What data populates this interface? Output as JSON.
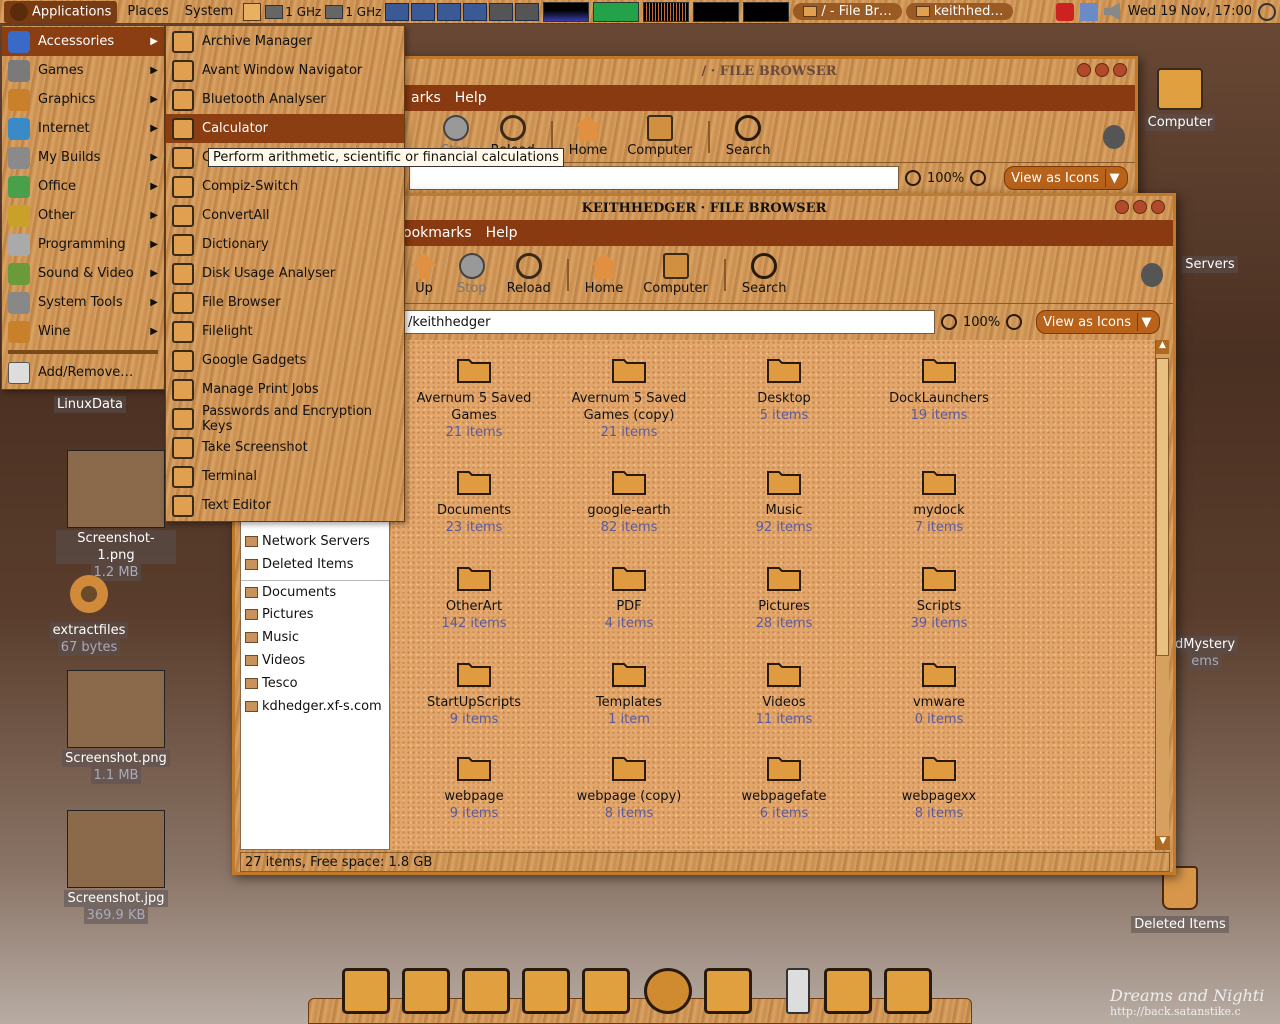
{
  "top_panel": {
    "applications": "Applications",
    "places": "Places",
    "system": "System",
    "cpu1": "1 GHz",
    "cpu2": "1 GHz",
    "task1": "/ - File Br…",
    "task2": "keithhed…",
    "clock": "Wed 19 Nov, 17:00"
  },
  "apps_menu": {
    "items": [
      {
        "label": "Accessories",
        "icon": "accessories-icon"
      },
      {
        "label": "Games",
        "icon": "games-icon"
      },
      {
        "label": "Graphics",
        "icon": "graphics-icon"
      },
      {
        "label": "Internet",
        "icon": "internet-icon"
      },
      {
        "label": "My Builds",
        "icon": "my-builds-icon"
      },
      {
        "label": "Office",
        "icon": "office-icon"
      },
      {
        "label": "Other",
        "icon": "other-icon"
      },
      {
        "label": "Programming",
        "icon": "programming-icon"
      },
      {
        "label": "Sound & Video",
        "icon": "sound-video-icon"
      },
      {
        "label": "System Tools",
        "icon": "system-tools-icon"
      },
      {
        "label": "Wine",
        "icon": "wine-icon"
      }
    ],
    "add_remove": "Add/Remove…"
  },
  "accessories_menu": {
    "items": [
      "Archive Manager",
      "Avant Window Navigator",
      "Bluetooth Analyser",
      "Calculator",
      "C",
      "Compiz-Switch",
      "ConvertAll",
      "Dictionary",
      "Disk Usage Analyser",
      "File Browser",
      "Filelight",
      "Google Gadgets",
      "Manage Print Jobs",
      "Passwords and Encryption Keys",
      "Take Screenshot",
      "Terminal",
      "Text Editor"
    ],
    "tooltip": "Perform arithmetic, scientific or financial calculations"
  },
  "back_window": {
    "title": "/ · FILE BROWSER",
    "menu_marks": "arks",
    "menu_help": "Help",
    "stop": "Stop",
    "reload": "Reload",
    "home": "Home",
    "computer": "Computer",
    "search": "Search",
    "zoom": "100%",
    "view": "View as Icons"
  },
  "front_window": {
    "title": "KEITHHEDGER · FILE BROWSER",
    "menu_bookmarks": "ookmarks",
    "menu_help": "Help",
    "up": "Up",
    "stop": "Stop",
    "reload": "Reload",
    "home": "Home",
    "computer": "Computer",
    "search": "Search",
    "location": "/keithhedger",
    "zoom": "100%",
    "view": "View as Icons",
    "status": "27 items, Free space: 1.8 GB",
    "sidebar": [
      {
        "label": "Network Servers",
        "icon": "network-icon"
      },
      {
        "label": "Deleted Items",
        "icon": "trash-icon"
      },
      {
        "label": "Documents",
        "icon": "folder-icon"
      },
      {
        "label": "Pictures",
        "icon": "folder-icon"
      },
      {
        "label": "Music",
        "icon": "folder-icon"
      },
      {
        "label": "Videos",
        "icon": "folder-icon"
      },
      {
        "label": "Tesco",
        "icon": "folder-icon"
      },
      {
        "label": "kdhedger.xf-s.com",
        "icon": "folder-icon"
      }
    ],
    "files": [
      {
        "name": "Avernum 5 Saved Games",
        "count": "21 items"
      },
      {
        "name": "Avernum 5 Saved Games (copy)",
        "count": "21 items"
      },
      {
        "name": "Desktop",
        "count": "5 items"
      },
      {
        "name": "DockLaunchers",
        "count": "19 items"
      },
      {
        "name": "Documents",
        "count": "23 items"
      },
      {
        "name": "google-earth",
        "count": "82 items"
      },
      {
        "name": "Music",
        "count": "92 items"
      },
      {
        "name": "mydock",
        "count": "7 items"
      },
      {
        "name": "OtherArt",
        "count": "142 items"
      },
      {
        "name": "PDF",
        "count": "4 items"
      },
      {
        "name": "Pictures",
        "count": "28 items"
      },
      {
        "name": "Scripts",
        "count": "39 items"
      },
      {
        "name": "StartUpScripts",
        "count": "9 items"
      },
      {
        "name": "Templates",
        "count": "1 item"
      },
      {
        "name": "Videos",
        "count": "11 items"
      },
      {
        "name": "vmware",
        "count": "0 items"
      },
      {
        "name": "webpage",
        "count": "9 items"
      },
      {
        "name": "webpage (copy)",
        "count": "8 items"
      },
      {
        "name": "webpagefate",
        "count": "6 items"
      },
      {
        "name": "webpagexx",
        "count": "8 items"
      }
    ]
  },
  "desktop": {
    "linuxdata": "LinuxData",
    "shot1_name": "Screenshot-1.png",
    "shot1_size": "1.2 MB",
    "extract_name": "extractfiles",
    "extract_size": "67 bytes",
    "shot2_name": "Screenshot.png",
    "shot2_size": "1.1 MB",
    "shot3_name": "Screenshot.jpg",
    "shot3_size": "369.9 KB",
    "computer": "Computer",
    "servers": "Servers",
    "mystery": "dMystery",
    "mystery_sub": "ems",
    "deleted": "Deleted Items"
  },
  "wallpaper_text": {
    "line1": "Dreams and Nighti",
    "line2": "http://back.satanstike.c"
  },
  "colors": {
    "accent": "#8a3e12",
    "wood": "#d39a5a",
    "cork": "#e3a66a",
    "count_text": "#5a5aa0"
  }
}
